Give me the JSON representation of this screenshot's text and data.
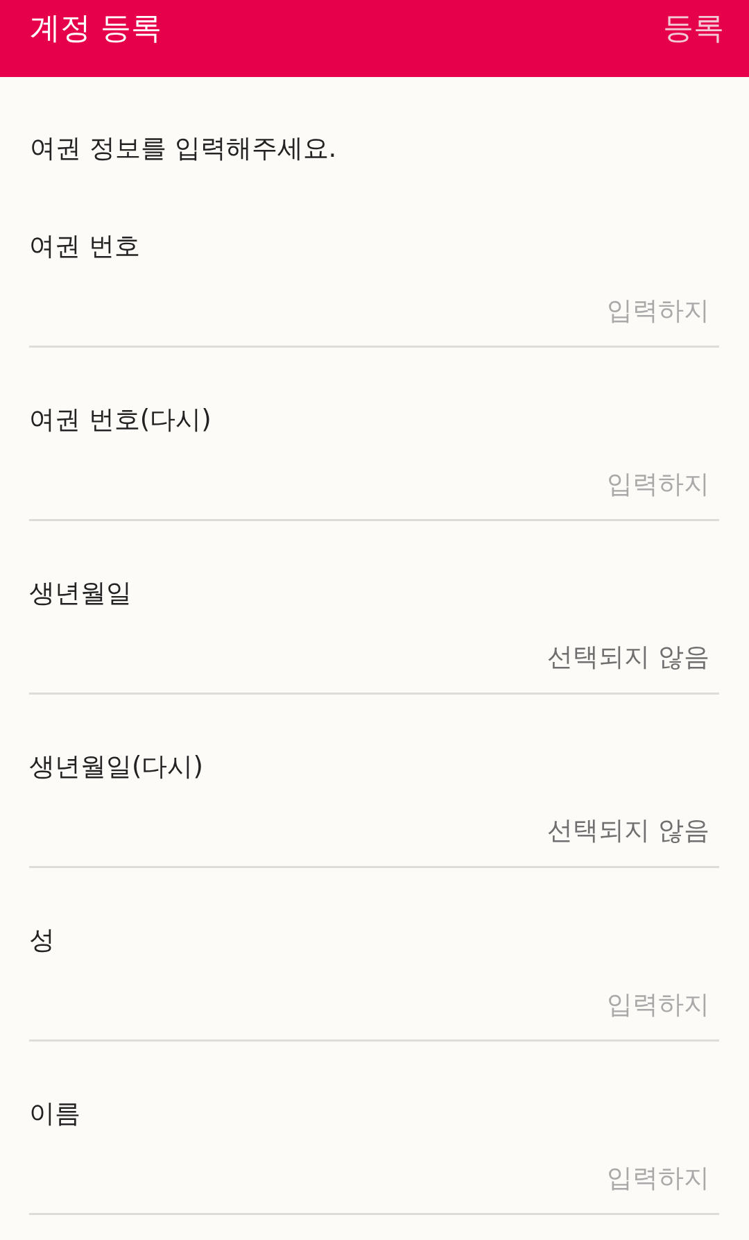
{
  "app_bar": {
    "title": "계정 등록",
    "action": {
      "label": "등록",
      "disabled": true
    }
  },
  "instructions": "여권 정보를 입력해주세요.",
  "fields": [
    {
      "kind": "text",
      "label": "여권 번호",
      "placeholder": "입력하지"
    },
    {
      "kind": "text",
      "label": "여권 번호(다시)",
      "placeholder": "입력하지"
    },
    {
      "kind": "picker",
      "label": "생년월일",
      "value": "선택되지 않음"
    },
    {
      "kind": "picker",
      "label": "생년월일(다시)",
      "value": "선택되지 않음"
    },
    {
      "kind": "text",
      "label": "성",
      "placeholder": "입력하지"
    },
    {
      "kind": "text",
      "label": "이름",
      "placeholder": "입력하지"
    }
  ]
}
